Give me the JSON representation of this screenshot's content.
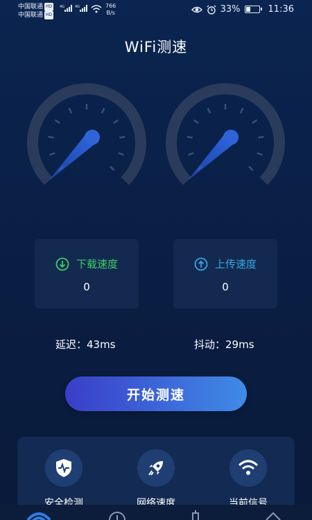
{
  "status_bar": {
    "carrier1": "中国联通",
    "carrier2": "中国联通",
    "hd_badge": "HD",
    "net_speed_value": "766",
    "net_speed_unit": "B/s",
    "battery": "33%",
    "time": "11:36"
  },
  "header": {
    "title": "WiFi测速"
  },
  "gauges": {
    "download_needle": 0,
    "upload_needle": 0
  },
  "download": {
    "label": "下载速度",
    "value": "0"
  },
  "upload": {
    "label": "上传速度",
    "value": "0"
  },
  "latency": {
    "text": "延迟：43ms"
  },
  "jitter": {
    "text": "抖动：29ms"
  },
  "start_button": {
    "label": "开始测速"
  },
  "tools": [
    {
      "label": "安全检测",
      "icon": "shield-pulse-icon"
    },
    {
      "label": "网络速度",
      "icon": "rocket-icon"
    },
    {
      "label": "当前信号",
      "icon": "wifi-icon"
    }
  ],
  "bottom_nav": [
    {
      "icon": "wifi-icon"
    },
    {
      "icon": "speed-icon"
    },
    {
      "icon": "tool-icon"
    },
    {
      "icon": "profile-icon"
    }
  ],
  "colors": {
    "background": "#0b2550",
    "download_accent": "#3ad06a",
    "upload_accent": "#35a7e6",
    "button_start": "#3a3ec9",
    "button_end": "#3f8be6"
  }
}
